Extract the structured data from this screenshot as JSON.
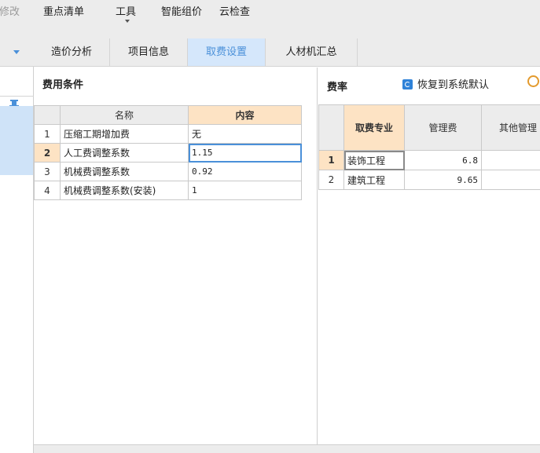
{
  "toolbar": {
    "items": [
      "修改",
      "重点清单",
      "工具",
      "智能组价",
      "云检查"
    ]
  },
  "tabs": [
    "造价分析",
    "项目信息",
    "取费设置",
    "人材机汇总"
  ],
  "active_tab": "取费设置",
  "conditions": {
    "title": "费用条件",
    "col_name": "名称",
    "col_content": "内容",
    "rows": [
      {
        "no": "1",
        "name": "压缩工期增加费",
        "value": "无"
      },
      {
        "no": "2",
        "name": "人工费调整系数",
        "value": "1.15"
      },
      {
        "no": "3",
        "name": "机械费调整系数",
        "value": "0.92"
      },
      {
        "no": "4",
        "name": "机械费调整系数(安装)",
        "value": "1"
      }
    ]
  },
  "rates": {
    "title": "费率",
    "restore_label": "恢复到系统默认",
    "col_major": "取费专业",
    "col_mgmt": "管理费",
    "col_other": "其他管理",
    "rows": [
      {
        "no": "1",
        "major": "装饰工程",
        "mgmt": "6.8"
      },
      {
        "no": "2",
        "major": "建筑工程",
        "mgmt": "9.65"
      }
    ]
  },
  "colors": {
    "accent": "#4a90d9",
    "header_highlight": "#fde3c4",
    "active_tab_bg": "#d5e7fb",
    "toolbar_bg": "#ececec"
  }
}
